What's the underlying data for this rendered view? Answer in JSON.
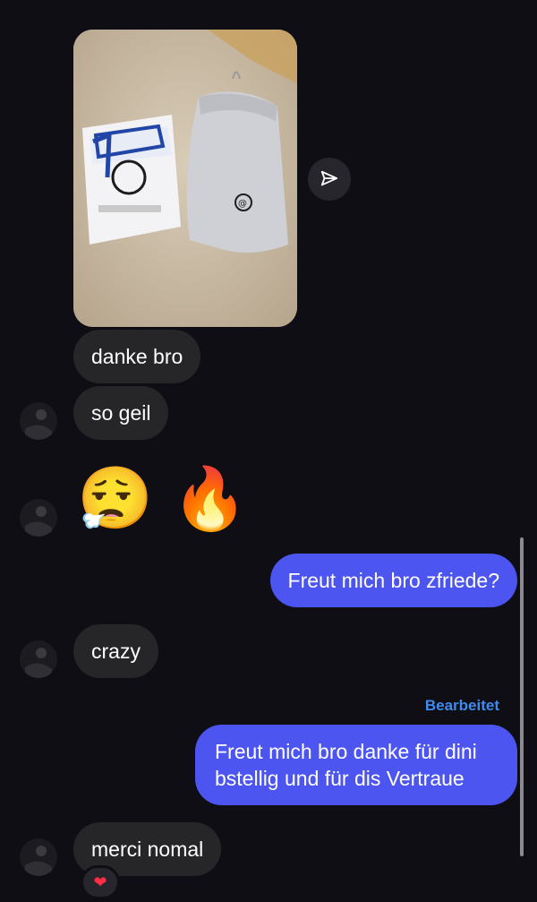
{
  "messages": {
    "m1": "danke bro",
    "m2": "so geil",
    "m3_emoji": "😮‍💨 🔥",
    "m4": "Freut mich bro zfriede?",
    "m5": "crazy",
    "m6_edited": "Bearbeitet",
    "m6": "Freut mich bro danke für dini bstellig und für dis Vertraue",
    "m7": "merci nomal",
    "m7_reaction": "❤"
  },
  "colors": {
    "incoming": "#262629",
    "outgoing": "#4d55f0",
    "edited_label": "#3e8bf0",
    "background": "#0e0e14"
  },
  "icons": {
    "share": "paper-plane-icon",
    "reaction": "heart-icon"
  }
}
